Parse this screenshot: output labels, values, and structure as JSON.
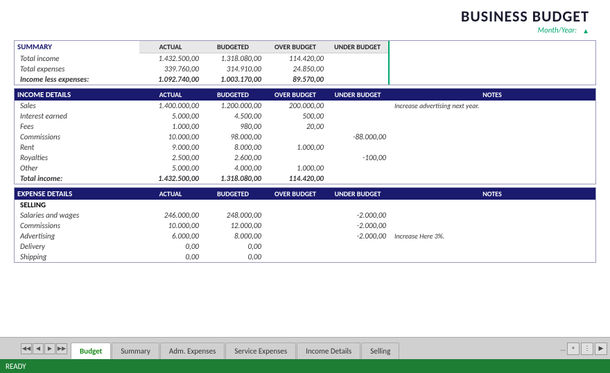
{
  "title": "BUSINESS BUDGET",
  "monthYearLabel": "Month/Year:",
  "summary": {
    "sectionName": "SUMMARY",
    "columns": [
      "ACTUAL",
      "BUDGETED",
      "OVER BUDGET",
      "UNDER BUDGET"
    ],
    "rows": [
      {
        "label": "Total income",
        "actual": "1.432.500,00",
        "budgeted": "1.318.080,00",
        "over": "114.420,00",
        "under": ""
      },
      {
        "label": "Total expenses",
        "actual": "339.760,00",
        "budgeted": "314.910,00",
        "over": "24.850,00",
        "under": ""
      },
      {
        "label": "Income less expenses:",
        "actual": "1.092.740,00",
        "budgeted": "1.003.170,00",
        "over": "89.570,00",
        "under": "",
        "bold": true
      }
    ]
  },
  "incomeDetails": {
    "sectionName": "INCOME DETAILS",
    "columns": [
      "ACTUAL",
      "BUDGETED",
      "OVER BUDGET",
      "UNDER BUDGET",
      "NOTES"
    ],
    "rows": [
      {
        "label": "Sales",
        "actual": "1.400.000,00",
        "budgeted": "1.200.000,00",
        "over": "200.000,00",
        "under": "",
        "notes": "Increase advertising next year."
      },
      {
        "label": "Interest earned",
        "actual": "5.000,00",
        "budgeted": "4.500,00",
        "over": "500,00",
        "under": "",
        "notes": ""
      },
      {
        "label": "Fees",
        "actual": "1.000,00",
        "budgeted": "980,00",
        "over": "20,00",
        "under": "",
        "notes": ""
      },
      {
        "label": "Commissions",
        "actual": "10.000,00",
        "budgeted": "98.000,00",
        "over": "",
        "under": "-88.000,00",
        "notes": ""
      },
      {
        "label": "Rent",
        "actual": "9.000,00",
        "budgeted": "8.000,00",
        "over": "1.000,00",
        "under": "",
        "notes": ""
      },
      {
        "label": "Royalties",
        "actual": "2.500,00",
        "budgeted": "2.600,00",
        "over": "",
        "under": "-100,00",
        "notes": ""
      },
      {
        "label": "Other",
        "actual": "5.000,00",
        "budgeted": "4.000,00",
        "over": "1.000,00",
        "under": "",
        "notes": ""
      },
      {
        "label": "Total income:",
        "actual": "1.432.500,00",
        "budgeted": "1.318.080,00",
        "over": "114.420,00",
        "under": "",
        "notes": "",
        "bold": true
      }
    ]
  },
  "expenseDetails": {
    "sectionName": "EXPENSE DETAILS",
    "columns": [
      "ACTUAL",
      "BUDGETED",
      "OVER BUDGET",
      "UNDER BUDGET",
      "NOTES"
    ],
    "selling": {
      "label": "SELLING",
      "rows": [
        {
          "label": "Salaries and wages",
          "actual": "246.000,00",
          "budgeted": "248.000,00",
          "over": "",
          "under": "-2.000,00",
          "notes": ""
        },
        {
          "label": "Commissions",
          "actual": "10.000,00",
          "budgeted": "12.000,00",
          "over": "",
          "under": "-2.000,00",
          "notes": ""
        },
        {
          "label": "Advertising",
          "actual": "6.000,00",
          "budgeted": "8.000,00",
          "over": "",
          "under": "-2.000,00",
          "notes": "Increase Here 3%."
        },
        {
          "label": "Delivery",
          "actual": "0,00",
          "budgeted": "0,00",
          "over": "",
          "under": "",
          "notes": ""
        },
        {
          "label": "Shipping",
          "actual": "0,00",
          "budgeted": "0,00",
          "over": "",
          "under": "",
          "notes": ""
        }
      ]
    }
  },
  "tabs": [
    {
      "label": "Budget",
      "active": true
    },
    {
      "label": "Summary",
      "active": false
    },
    {
      "label": "Adm. Expenses",
      "active": false
    },
    {
      "label": "Service Expenses",
      "active": false
    },
    {
      "label": "Income Details",
      "active": false
    },
    {
      "label": "Selling",
      "active": false
    }
  ],
  "statusBar": {
    "text": "READY"
  }
}
